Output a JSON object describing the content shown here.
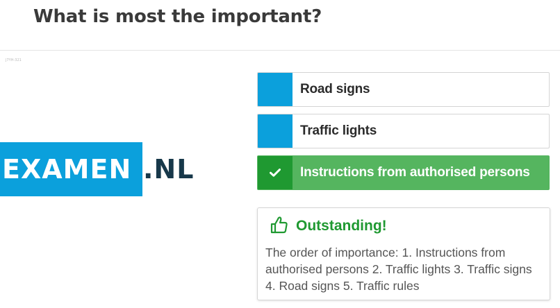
{
  "question": "What is most the important?",
  "image_id": "J7YH-321",
  "logo": {
    "word": "EXAMEN",
    "suffix": ".NL"
  },
  "options": [
    {
      "label": "Road signs",
      "state": "default"
    },
    {
      "label": "Traffic lights",
      "state": "default"
    },
    {
      "label": "Instructions from authorised persons",
      "state": "correct"
    }
  ],
  "feedback": {
    "title": "Outstanding!",
    "icon": "thumbs-up-icon",
    "text": "The order of importance: 1. Instructions from authorised persons 2. Traffic lights 3. Traffic signs 4. Road signs 5. Traffic rules"
  },
  "colors": {
    "accent_blue": "#0ba0dc",
    "correct_green": "#55b55f",
    "correct_dark_green": "#1f9931",
    "logo_dark": "#17384a",
    "question_text": "#3a3a3a"
  }
}
